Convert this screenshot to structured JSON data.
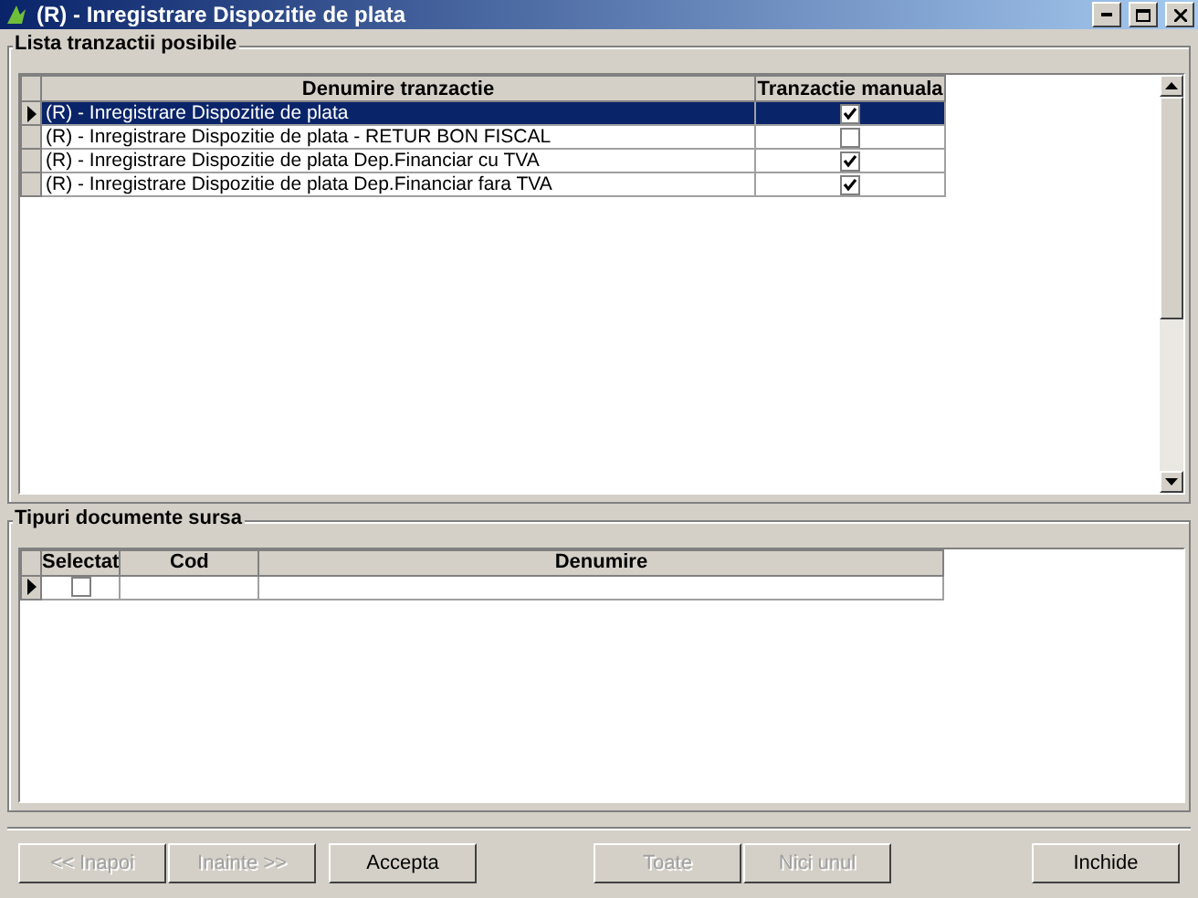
{
  "window": {
    "title": "(R) - Inregistrare Dispozitie de plata"
  },
  "transactions": {
    "title": "Lista tranzactii posibile",
    "columns": [
      "Denumire tranzactie",
      "Tranzactie manuala"
    ],
    "rows": [
      {
        "name": "(R) - Inregistrare Dispozitie de plata",
        "manual": true,
        "selected": true
      },
      {
        "name": "(R) - Inregistrare Dispozitie de plata - RETUR BON FISCAL",
        "manual": false,
        "selected": false
      },
      {
        "name": "(R) - Inregistrare Dispozitie de plata Dep.Financiar cu TVA",
        "manual": true,
        "selected": false
      },
      {
        "name": "(R) - Inregistrare Dispozitie de plata Dep.Financiar fara TVA",
        "manual": true,
        "selected": false
      }
    ]
  },
  "sources": {
    "title": "Tipuri documente sursa",
    "columns": [
      "Selectat",
      "Cod",
      "Denumire"
    ],
    "rows": [
      {
        "checked": false
      }
    ]
  },
  "buttons": [
    {
      "label": "<< Inapoi",
      "disabled": true
    },
    {
      "label": "Inainte >>",
      "disabled": true
    },
    {
      "label": "Accepta",
      "disabled": false
    },
    {
      "label": "Toate",
      "disabled": true
    },
    {
      "label": "Nici unul",
      "disabled": true
    },
    {
      "label": "Inchide",
      "disabled": false
    }
  ]
}
